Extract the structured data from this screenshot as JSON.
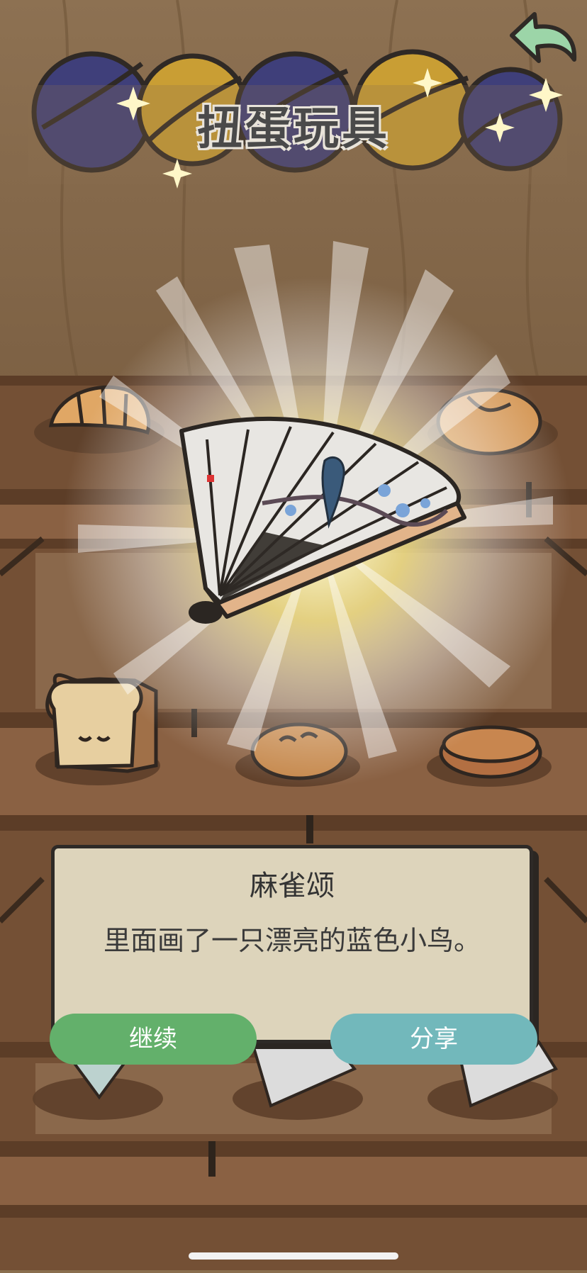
{
  "header": {
    "title": "扭蛋玩具"
  },
  "prize": {
    "name": "麻雀颂",
    "description": "里面画了一只漂亮的蓝色小鸟。"
  },
  "actions": {
    "continue_label": "继续",
    "share_label": "分享"
  },
  "icons": {
    "back": "back-arrow-icon",
    "prize": "folding-fan-icon"
  },
  "colors": {
    "continue": "#63b06b",
    "share": "#72b8bb",
    "dialog": "#ddd4bb",
    "shelf": "#6d4a31"
  }
}
